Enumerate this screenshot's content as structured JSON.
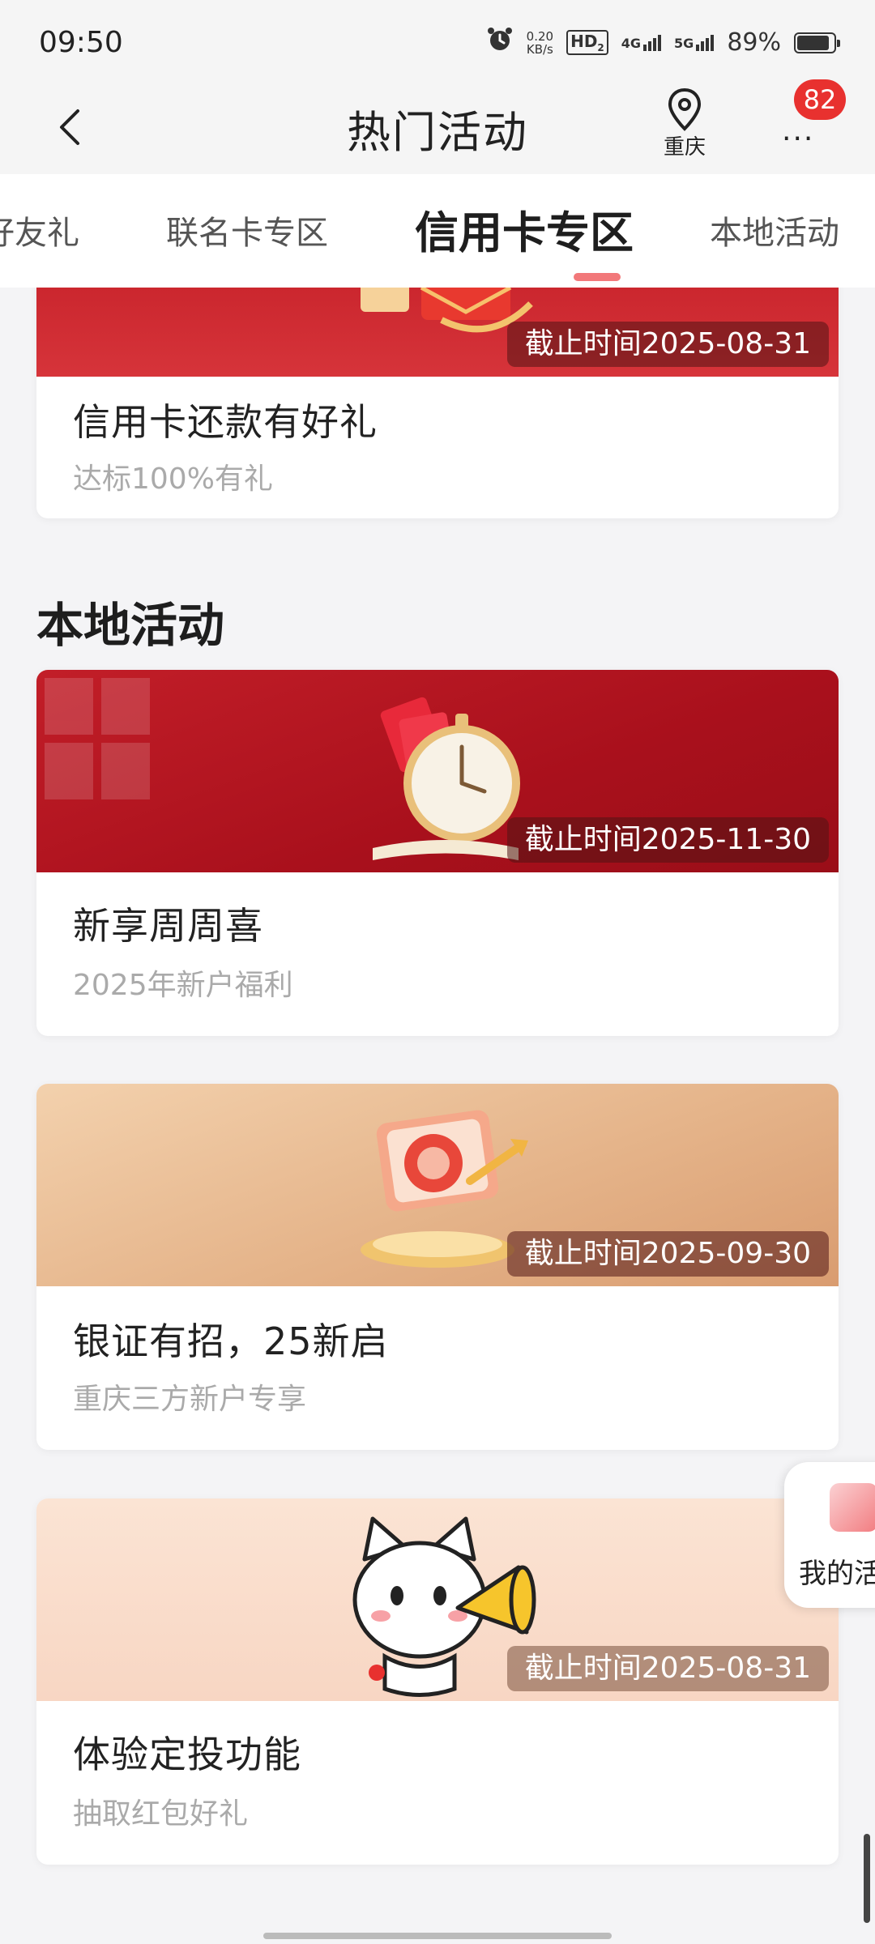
{
  "status_bar": {
    "time": "09:50",
    "speed_value": "0.20",
    "speed_unit": "KB/s",
    "hd": "HD",
    "hd_sub": "2",
    "net1": "4G",
    "net2": "5G",
    "battery": "89%"
  },
  "nav": {
    "title": "热门活动",
    "location": "重庆",
    "more_badge": "82"
  },
  "tabs": {
    "items": [
      "好友礼",
      "联名卡专区",
      "信用卡专区",
      "本地活动"
    ],
    "active_index": 2
  },
  "section": {
    "local_title": "本地活动"
  },
  "cards": [
    {
      "deadline": "截止时间2025-08-31",
      "title": "信用卡还款有好礼",
      "subtitle": "达标100%有礼"
    },
    {
      "deadline": "截止时间2025-11-30",
      "title": "新享周周喜",
      "subtitle": "2025年新户福利"
    },
    {
      "deadline": "截止时间2025-09-30",
      "title": "银证有招，25新启",
      "subtitle": "重庆三方新户专享"
    },
    {
      "deadline": "截止时间2025-08-31",
      "title": "体验定投功能",
      "subtitle": "抽取红包好礼"
    }
  ],
  "floating": {
    "label": "我的活"
  },
  "colors": {
    "accent_red": "#e8312f",
    "tab_indicator": "#f2787a",
    "banner_red": "#c8202a",
    "banner_gold": "#e4b48a",
    "banner_peach": "#fbe3d3"
  },
  "icons": [
    "alarm-icon",
    "back-chevron-icon",
    "location-pin-icon",
    "more-dots-icon",
    "gift-icon",
    "stopwatch-illustration",
    "lucky-cat-megaphone-illustration"
  ]
}
